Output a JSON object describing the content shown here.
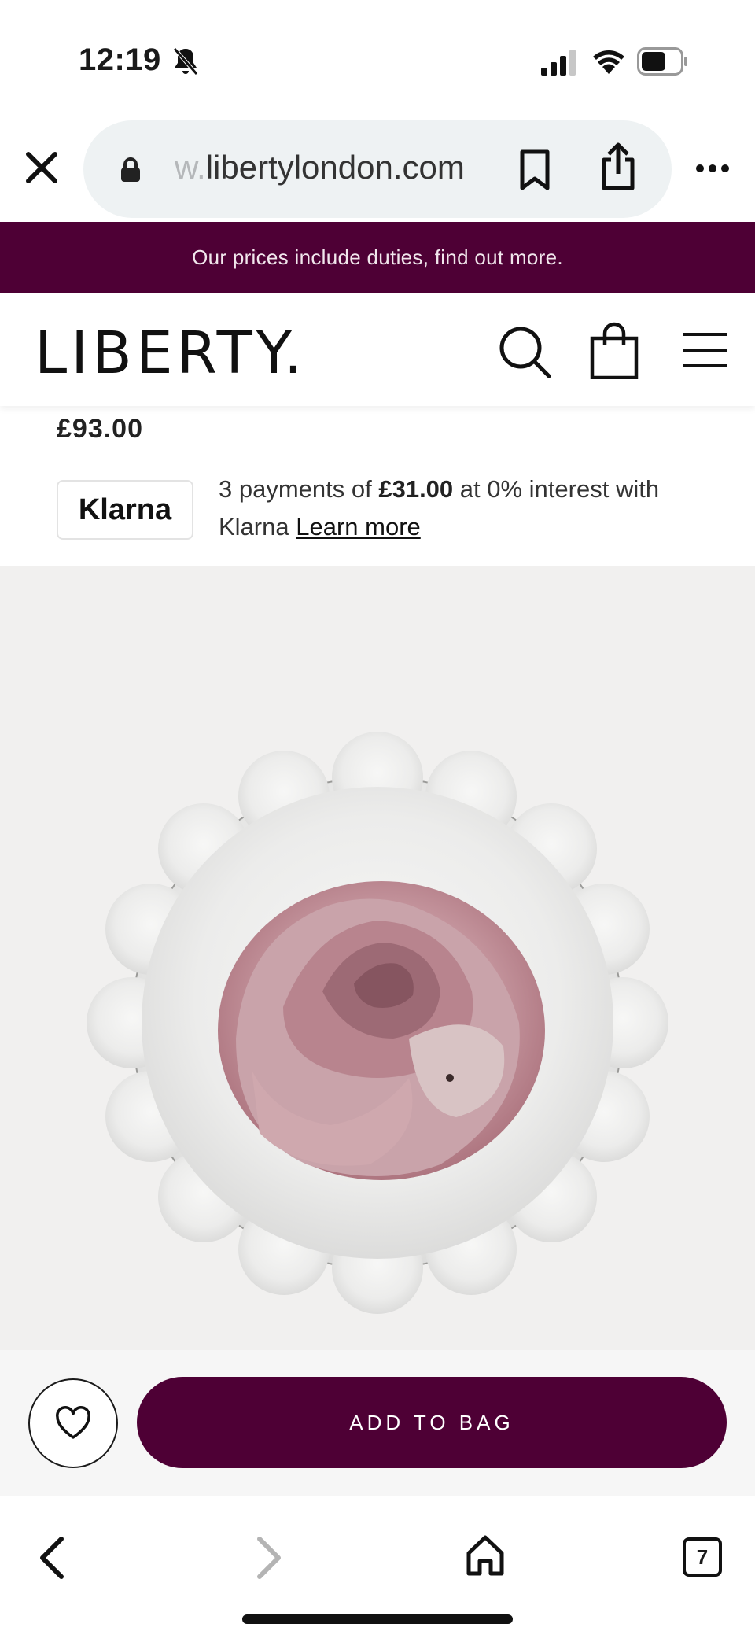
{
  "status_bar": {
    "time": "12:19",
    "icons": [
      "bell-muted-icon",
      "cellular-signal-icon",
      "wifi-icon",
      "battery-icon"
    ]
  },
  "browser": {
    "url_prefix": "w.",
    "url_domain": "libertylondon.com",
    "icons": [
      "close-icon",
      "lock-icon",
      "bookmark-icon",
      "share-icon",
      "more-icon"
    ]
  },
  "banner": {
    "text": "Our prices include duties, find out more.",
    "background": "#4e0035"
  },
  "header": {
    "logo": "LIBERTY.",
    "icons": [
      "search-icon",
      "shopping-bag-icon",
      "hamburger-menu-icon"
    ]
  },
  "product": {
    "price": "£93.00",
    "image": "scalloped white plate with pink rose"
  },
  "klarna": {
    "badge": "Klarna",
    "text_before": "3 payments of ",
    "amount": "£31.00",
    "text_after": " at 0% interest with Klarna ",
    "learn_more": "Learn more"
  },
  "actions": {
    "add_to_bag": "ADD TO BAG",
    "wishlist_icon": "heart-icon",
    "accent": "#4e0035"
  },
  "bottom_nav": {
    "tab_count": "7",
    "icons": [
      "back-arrow-icon",
      "forward-arrow-icon",
      "home-icon",
      "tabs-icon"
    ]
  }
}
